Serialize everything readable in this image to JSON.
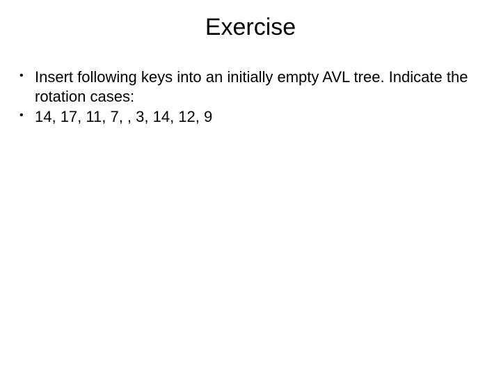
{
  "title": "Exercise",
  "bullets": [
    "Insert following keys into an initially empty AVL tree. Indicate the rotation cases:",
    "14, 17, 11, 7, , 3, 14, 12, 9"
  ]
}
